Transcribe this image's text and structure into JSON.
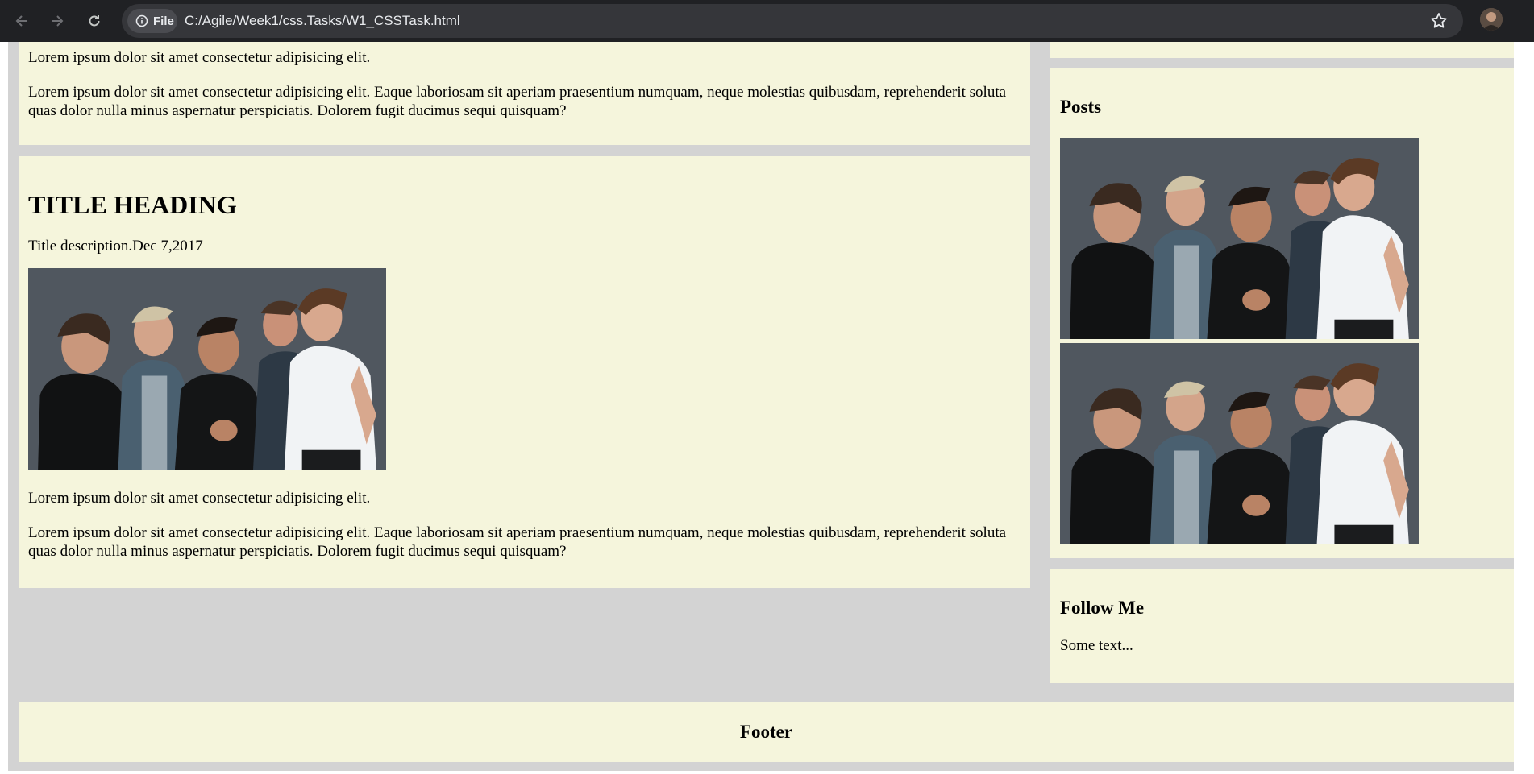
{
  "browser": {
    "file_chip": "File",
    "url": "C:/Agile/Week1/css.Tasks/W1_CSSTask.html"
  },
  "article1": {
    "short_text": "Lorem ipsum dolor sit amet consectetur adipisicing elit.",
    "long_text": "Lorem ipsum dolor sit amet consectetur adipisicing elit. Eaque laboriosam sit aperiam praesentium numquam, neque molestias quibusdam, reprehenderit soluta quas dolor nulla minus aspernatur perspiciatis. Dolorem fugit ducimus sequi quisquam?"
  },
  "article2": {
    "title": "TITLE HEADING",
    "description": "Title description.Dec 7,2017",
    "short_text": "Lorem ipsum dolor sit amet consectetur adipisicing elit.",
    "long_text": "Lorem ipsum dolor sit amet consectetur adipisicing elit. Eaque laboriosam sit aperiam praesentium numquam, neque molestias quibusdam, reprehenderit soluta quas dolor nulla minus aspernatur perspiciatis. Dolorem fugit ducimus sequi quisquam?"
  },
  "sidebar": {
    "posts_heading": "Posts",
    "follow_heading": "Follow Me",
    "follow_text": "Some text..."
  },
  "footer": {
    "label": "Footer"
  },
  "colors": {
    "card_bg": "#f5f5dc",
    "page_bg": "#d3d3d3",
    "chrome_bg": "#202124"
  }
}
